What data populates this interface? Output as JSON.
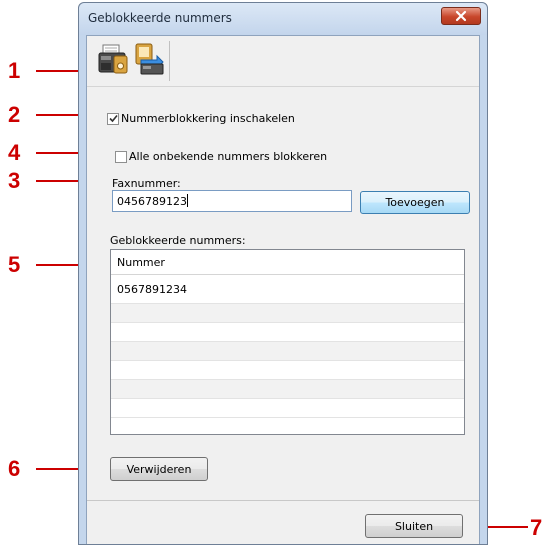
{
  "window": {
    "title": "Geblokkeerde nummers",
    "close_icon": "close-x-icon"
  },
  "toolbar": {
    "icons": [
      "fax-machine-icon",
      "fax-to-pc-icon"
    ]
  },
  "enable_blocking": {
    "label": "Nummerblokkering inschakelen",
    "checked": true
  },
  "block_unknown": {
    "label": "Alle onbekende nummers blokkeren",
    "checked": false
  },
  "fax_number": {
    "label": "Faxnummer:",
    "value": "0456789123"
  },
  "add_button": {
    "label": "Toevoegen"
  },
  "blocked_list": {
    "label": "Geblokkeerde nummers:",
    "column_header": "Nummer",
    "rows": [
      "0567891234",
      "",
      "",
      "",
      "",
      "",
      ""
    ]
  },
  "delete_button": {
    "label": "Verwijderen"
  },
  "close_button": {
    "label": "Sluiten"
  },
  "callouts": [
    "1",
    "2",
    "4",
    "3",
    "5",
    "6",
    "7"
  ],
  "colors": {
    "callout": "#cc0000",
    "window_frame": "#c4d6ec",
    "dialog_bg": "#f0f0f0"
  }
}
